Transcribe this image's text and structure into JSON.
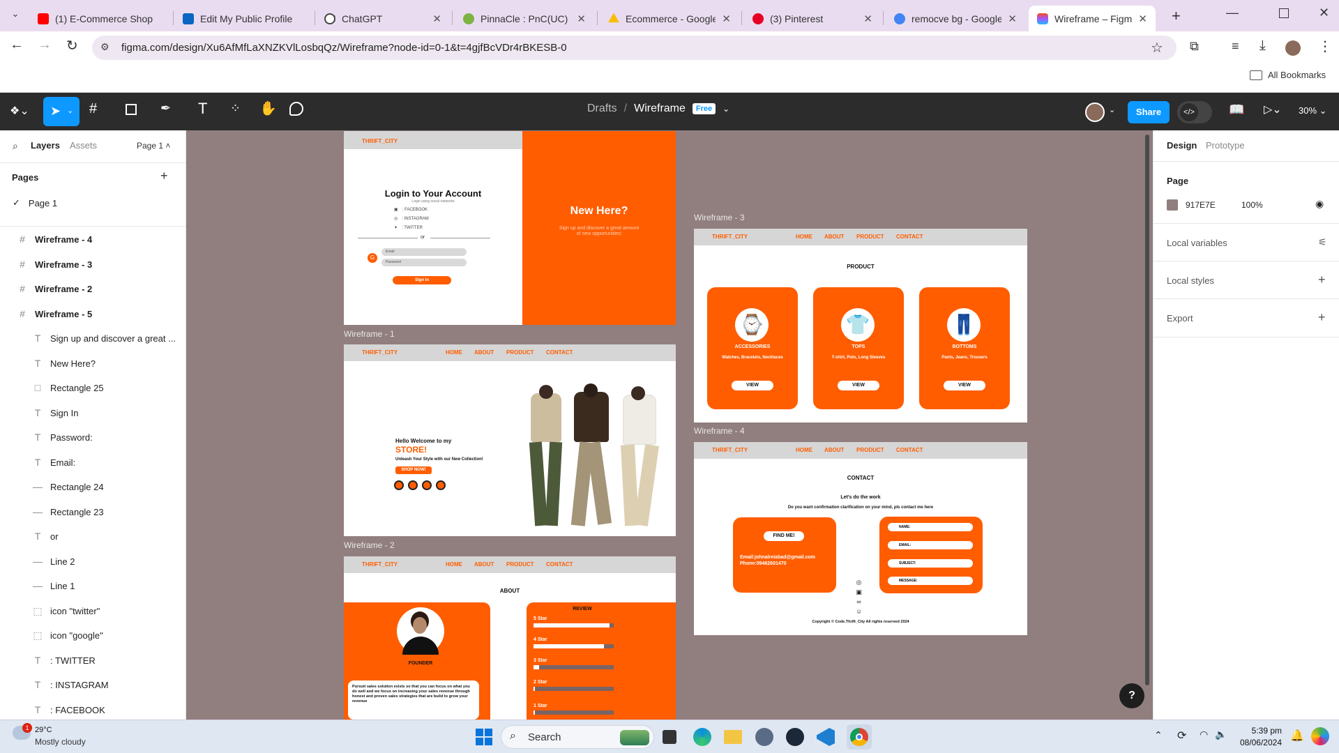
{
  "browser": {
    "tabs": [
      {
        "title": "(1) E-Commerce Shop",
        "color": "#ff0000"
      },
      {
        "title": "Edit My Public Profile",
        "color": "#0a66c2"
      },
      {
        "title": "ChatGPT",
        "color": "#444444"
      },
      {
        "title": "PinnaCle : PnC(UC) Le",
        "color": "#7cb342"
      },
      {
        "title": "Ecommerce - Google",
        "color": "#fbbc04"
      },
      {
        "title": "(3) Pinterest",
        "color": "#e60023"
      },
      {
        "title": "remocve bg - Google",
        "color": "#4285f4"
      },
      {
        "title": "Wireframe – Figma",
        "color": "#a259ff"
      }
    ],
    "url": "figma.com/design/Xu6AfMfLaXNZKVlLosbqQz/Wireframe?node-id=0-1&t=4gjfBcVDr4rBKESB-0",
    "bookmarks": "All Bookmarks"
  },
  "figma": {
    "breadcrumb_drafts": "Drafts",
    "breadcrumb_sep": "/",
    "file_name": "Wireframe",
    "plan_badge": "Free",
    "share": "Share",
    "zoom": "30%",
    "left": {
      "tab_layers": "Layers",
      "tab_assets": "Assets",
      "page_selector": "Page 1",
      "pages_header": "Pages",
      "page_item": "Page 1",
      "frames": [
        "Wireframe - 4",
        "Wireframe - 3",
        "Wireframe - 2",
        "Wireframe - 5"
      ],
      "layers": [
        {
          "icon": "T",
          "label": "Sign up and discover a great ..."
        },
        {
          "icon": "T",
          "label": "New Here?"
        },
        {
          "icon": "□",
          "label": "Rectangle 25"
        },
        {
          "icon": "T",
          "label": "Sign In"
        },
        {
          "icon": "T",
          "label": "Password:"
        },
        {
          "icon": "T",
          "label": "Email:"
        },
        {
          "icon": "—",
          "label": "Rectangle 24"
        },
        {
          "icon": "—",
          "label": "Rectangle 23"
        },
        {
          "icon": "T",
          "label": "or"
        },
        {
          "icon": "—",
          "label": "Line 2"
        },
        {
          "icon": "—",
          "label": "Line 1"
        },
        {
          "icon": "⬚",
          "label": "icon \"twitter\""
        },
        {
          "icon": "⬚",
          "label": "icon \"google\""
        },
        {
          "icon": "T",
          "label": ": TWITTER"
        },
        {
          "icon": "T",
          "label": ": INSTAGRAM"
        },
        {
          "icon": "T",
          "label": ": FACEBOOK"
        }
      ]
    },
    "right": {
      "tab_design": "Design",
      "tab_prototype": "Prototype",
      "page_label": "Page",
      "page_color_hex": "917E7E",
      "page_color": "#917e7e",
      "opacity": "100%",
      "local_variables": "Local variables",
      "local_styles": "Local styles",
      "export": "Export"
    }
  },
  "wireframes": {
    "brand": "THRIFT_CITY",
    "nav": [
      "HOME",
      "ABOUT",
      "PRODUCT",
      "CONTACT"
    ],
    "login": {
      "title": "Login to Your Account",
      "subtitle": "Login using social networks",
      "facebook": ": FACEBOOK",
      "instagram": ": INSTAGRAM",
      "twitter": ": TWITTER",
      "or": "or",
      "email": "Email",
      "password": "Password",
      "signin": "Sign In",
      "new_here": "New Here?",
      "new_sub": "Sign up and discover a great amount of new opportunities!"
    },
    "label_1": "Wireframe - 1",
    "label_2": "Wireframe - 2",
    "label_3": "Wireframe - 3",
    "label_4": "Wireframe - 4",
    "home": {
      "hello": "Hello Welcome to my",
      "store": "STORE!",
      "tagline": "Unleash Your Style with our New Collection!",
      "cta": "SHOP NOW!"
    },
    "about": {
      "title": "ABOUT",
      "founder": "FOUNDER",
      "text": "Pursuit sales solution exists so that you can focus on what you do well and we focus on increasing your sales revenue through honest and proven sales strategies that are build to grow your revenue",
      "review": "REVIEW",
      "ratings": [
        {
          "label": "5 Star",
          "level": 0.95
        },
        {
          "label": "4 Star",
          "level": 0.88
        },
        {
          "label": "3 Star",
          "level": 0.07
        },
        {
          "label": "2 Star",
          "level": 0.02
        },
        {
          "label": "1 Star",
          "level": 0.02
        }
      ]
    },
    "product": {
      "title": "PRODUCT",
      "cards": [
        {
          "title": "ACCESSORIES",
          "sub": "Watches, Bracelets, Necklaces",
          "icon": "⌚",
          "btn": "VIEW"
        },
        {
          "title": "TOPS",
          "sub": "T-shirt, Polo, Long Sleeves",
          "icon": "👕",
          "btn": "VIEW"
        },
        {
          "title": "BOTTOMS",
          "sub": "Pants, Jeans, Trousers",
          "icon": "👖",
          "btn": "VIEW"
        }
      ]
    },
    "contact": {
      "title": "CONTACT",
      "headline": "Let's do the work",
      "sub": "Do you want confirmation clarification on your mind, pls contact me here",
      "find": "FIND ME!",
      "email": "Email:johnalreiabad@gmail.com",
      "phone": "Phone:09482601470",
      "fields": [
        "NAME:",
        "EMAIL:",
        "SUBJECT:",
        "MESSAGE:"
      ],
      "copyright": "Copyright © Code.Thrift_City All rights reserved 2024"
    }
  },
  "taskbar": {
    "weather_temp": "29°C",
    "weather_desc": "Mostly cloudy",
    "weather_badge": "1",
    "search": "Search",
    "time": "5:39 pm",
    "date": "08/06/2024"
  }
}
